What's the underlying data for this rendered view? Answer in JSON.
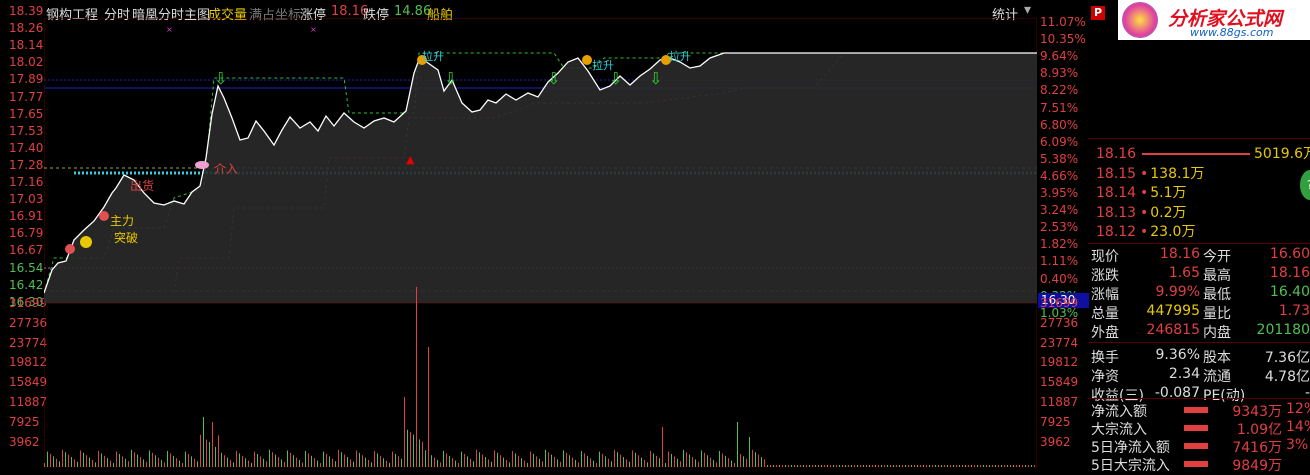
{
  "topbar": {
    "stock_name": "钢构工程",
    "view": "分时",
    "indicator": "暗凰分时主图",
    "volume_label": "成交量",
    "fill_label": "满占坐标",
    "limit_up_label": "涨停",
    "limit_up_value": "18.16",
    "limit_down_label": "跌停",
    "limit_down_value": "14.86",
    "extra": "船舶",
    "stats_label": "统计"
  },
  "left_axis": [
    "18.39",
    "18.26",
    "18.14",
    "18.02",
    "17.89",
    "17.77",
    "17.65",
    "17.53",
    "17.40",
    "17.28",
    "17.16",
    "17.03",
    "16.91",
    "16.79",
    "16.67",
    "16.54",
    "16.42",
    "16.30"
  ],
  "right_axis": [
    "11.07%",
    "10.35%",
    "9.64%",
    "8.93%",
    "8.22%",
    "7.51%",
    "6.80%",
    "6.09%",
    "5.38%",
    "4.66%",
    "3.95%",
    "3.24%",
    "2.53%",
    "1.82%",
    "1.11%",
    "0.40%",
    "0.32%",
    "1.03%"
  ],
  "current_price_tag": "16.30",
  "volume_axis": [
    "31699",
    "27736",
    "23774",
    "19812",
    "15849",
    "11887",
    "7925",
    "3962"
  ],
  "chart_labels": {
    "main_force": "主力",
    "breakthrough": "突破",
    "top_label": "拉升",
    "mid_label": "拉升",
    "mid2_label": "拉升",
    "shoot": "出货",
    "enter": "介入"
  },
  "logo": {
    "brand": "分析家公式网",
    "url": "www.88gs.com"
  },
  "order_book": [
    {
      "price": "18.16",
      "volume": "5019.6万",
      "top": true
    },
    {
      "price": "18.15",
      "volume": "138.1万"
    },
    {
      "price": "18.14",
      "volume": "5.1万"
    },
    {
      "price": "18.13",
      "volume": "0.2万"
    },
    {
      "price": "18.12",
      "volume": "23.0万"
    }
  ],
  "quote": {
    "price_label": "现价",
    "price": "18.16",
    "open_label": "今开",
    "open": "16.60",
    "change_label": "涨跌",
    "change": "1.65",
    "high_label": "最高",
    "high": "18.16",
    "pct_label": "涨幅",
    "pct": "9.99%",
    "low_label": "最低",
    "low": "16.40",
    "vol_label": "总量",
    "vol": "447995",
    "ratio_label": "量比",
    "ratio": "1.73",
    "outer_label": "外盘",
    "outer": "246815",
    "inner_label": "内盘",
    "inner": "201180",
    "turnover_label": "换手",
    "turnover": "9.36%",
    "equity_label": "股本",
    "equity": "7.36亿",
    "nav_label": "净资",
    "nav": "2.34",
    "float_label": "流通",
    "float": "4.78亿",
    "eps_label": "收益(三)",
    "eps": "-0.087",
    "pe_label": "PE(动)",
    "pe": "-"
  },
  "flows": [
    {
      "label": "净流入额",
      "value": "9343万",
      "pct": "12%"
    },
    {
      "label": "大宗流入",
      "value": "1.09亿",
      "pct": "14%"
    },
    {
      "label": "5日净流入额",
      "value": "7416万",
      "pct": "3%"
    },
    {
      "label": "5日大宗流入",
      "value": "9849万",
      "pct": ""
    }
  ],
  "colors": {
    "up": "#e04040",
    "down": "#50c050",
    "price_line": "#ffffff",
    "bg": "#000000",
    "gold": "#e8c800"
  }
}
